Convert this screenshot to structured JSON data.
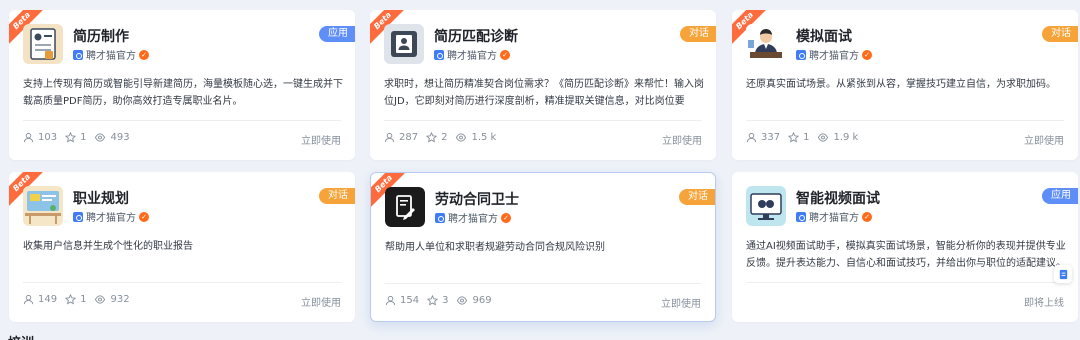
{
  "cards": [
    {
      "badge": "Beta",
      "tag": "应用",
      "title": "简历制作",
      "author": "聘才猫官方",
      "desc": "支持上传现有简历或智能引导新建简历，海量模板随心选，一键生成并下载高质量PDF简历，助你高效打造专属职业名片。",
      "likes": "103",
      "stars": "1",
      "views": "493",
      "action": "立即使用",
      "icon": "resume-document-icon"
    },
    {
      "badge": "Beta",
      "tag": "对话",
      "title": "简历匹配诊断",
      "author": "聘才猫官方",
      "desc": "求职时，想让简历精准契合岗位需求？《简历匹配诊断》来帮忙！输入岗位JD，它即刻对简历进行深度剖析，精准提取关键信息，对比岗位要求，快...",
      "likes": "287",
      "stars": "2",
      "views": "1.5 k",
      "action": "立即使用",
      "icon": "id-card-icon"
    },
    {
      "badge": "Beta",
      "tag": "对话",
      "title": "模拟面试",
      "author": "聘才猫官方",
      "desc": "还原真实面试场景。从紧张到从容，掌握技巧建立自信，为求职加码。",
      "likes": "337",
      "stars": "1",
      "views": "1.9 k",
      "action": "立即使用",
      "icon": "interviewer-icon"
    },
    {
      "badge": "Beta",
      "tag": "对话",
      "title": "职业规划",
      "author": "聘才猫官方",
      "desc": "收集用户信息并生成个性化的职业报告",
      "likes": "149",
      "stars": "1",
      "views": "932",
      "action": "立即使用",
      "icon": "career-desk-icon"
    },
    {
      "badge": "Beta",
      "tag": "对话",
      "title": "劳动合同卫士",
      "author": "聘才猫官方",
      "desc": "帮助用人单位和求职者规避劳动合同合规风险识别",
      "likes": "154",
      "stars": "3",
      "views": "969",
      "action": "立即使用",
      "icon": "contract-shield-icon"
    },
    {
      "badge": "",
      "tag": "应用",
      "title": "智能视频面试",
      "author": "聘才猫官方",
      "desc": "通过AI视频面试助手，模拟真实面试场景，智能分析你的表现并提供专业反馈。提升表达能力、自信心和面试技巧，并给出你与职位的适配建议。",
      "likes": "",
      "stars": "",
      "views": "",
      "action": "即将上线",
      "icon": "video-camera-icon"
    }
  ],
  "section_title": "培训",
  "colors": {
    "apply_tag": "#5e8ef8",
    "chat_tag": "#f6a43a",
    "beta": "#ff6b3d",
    "brand": "#3f7cf6"
  }
}
